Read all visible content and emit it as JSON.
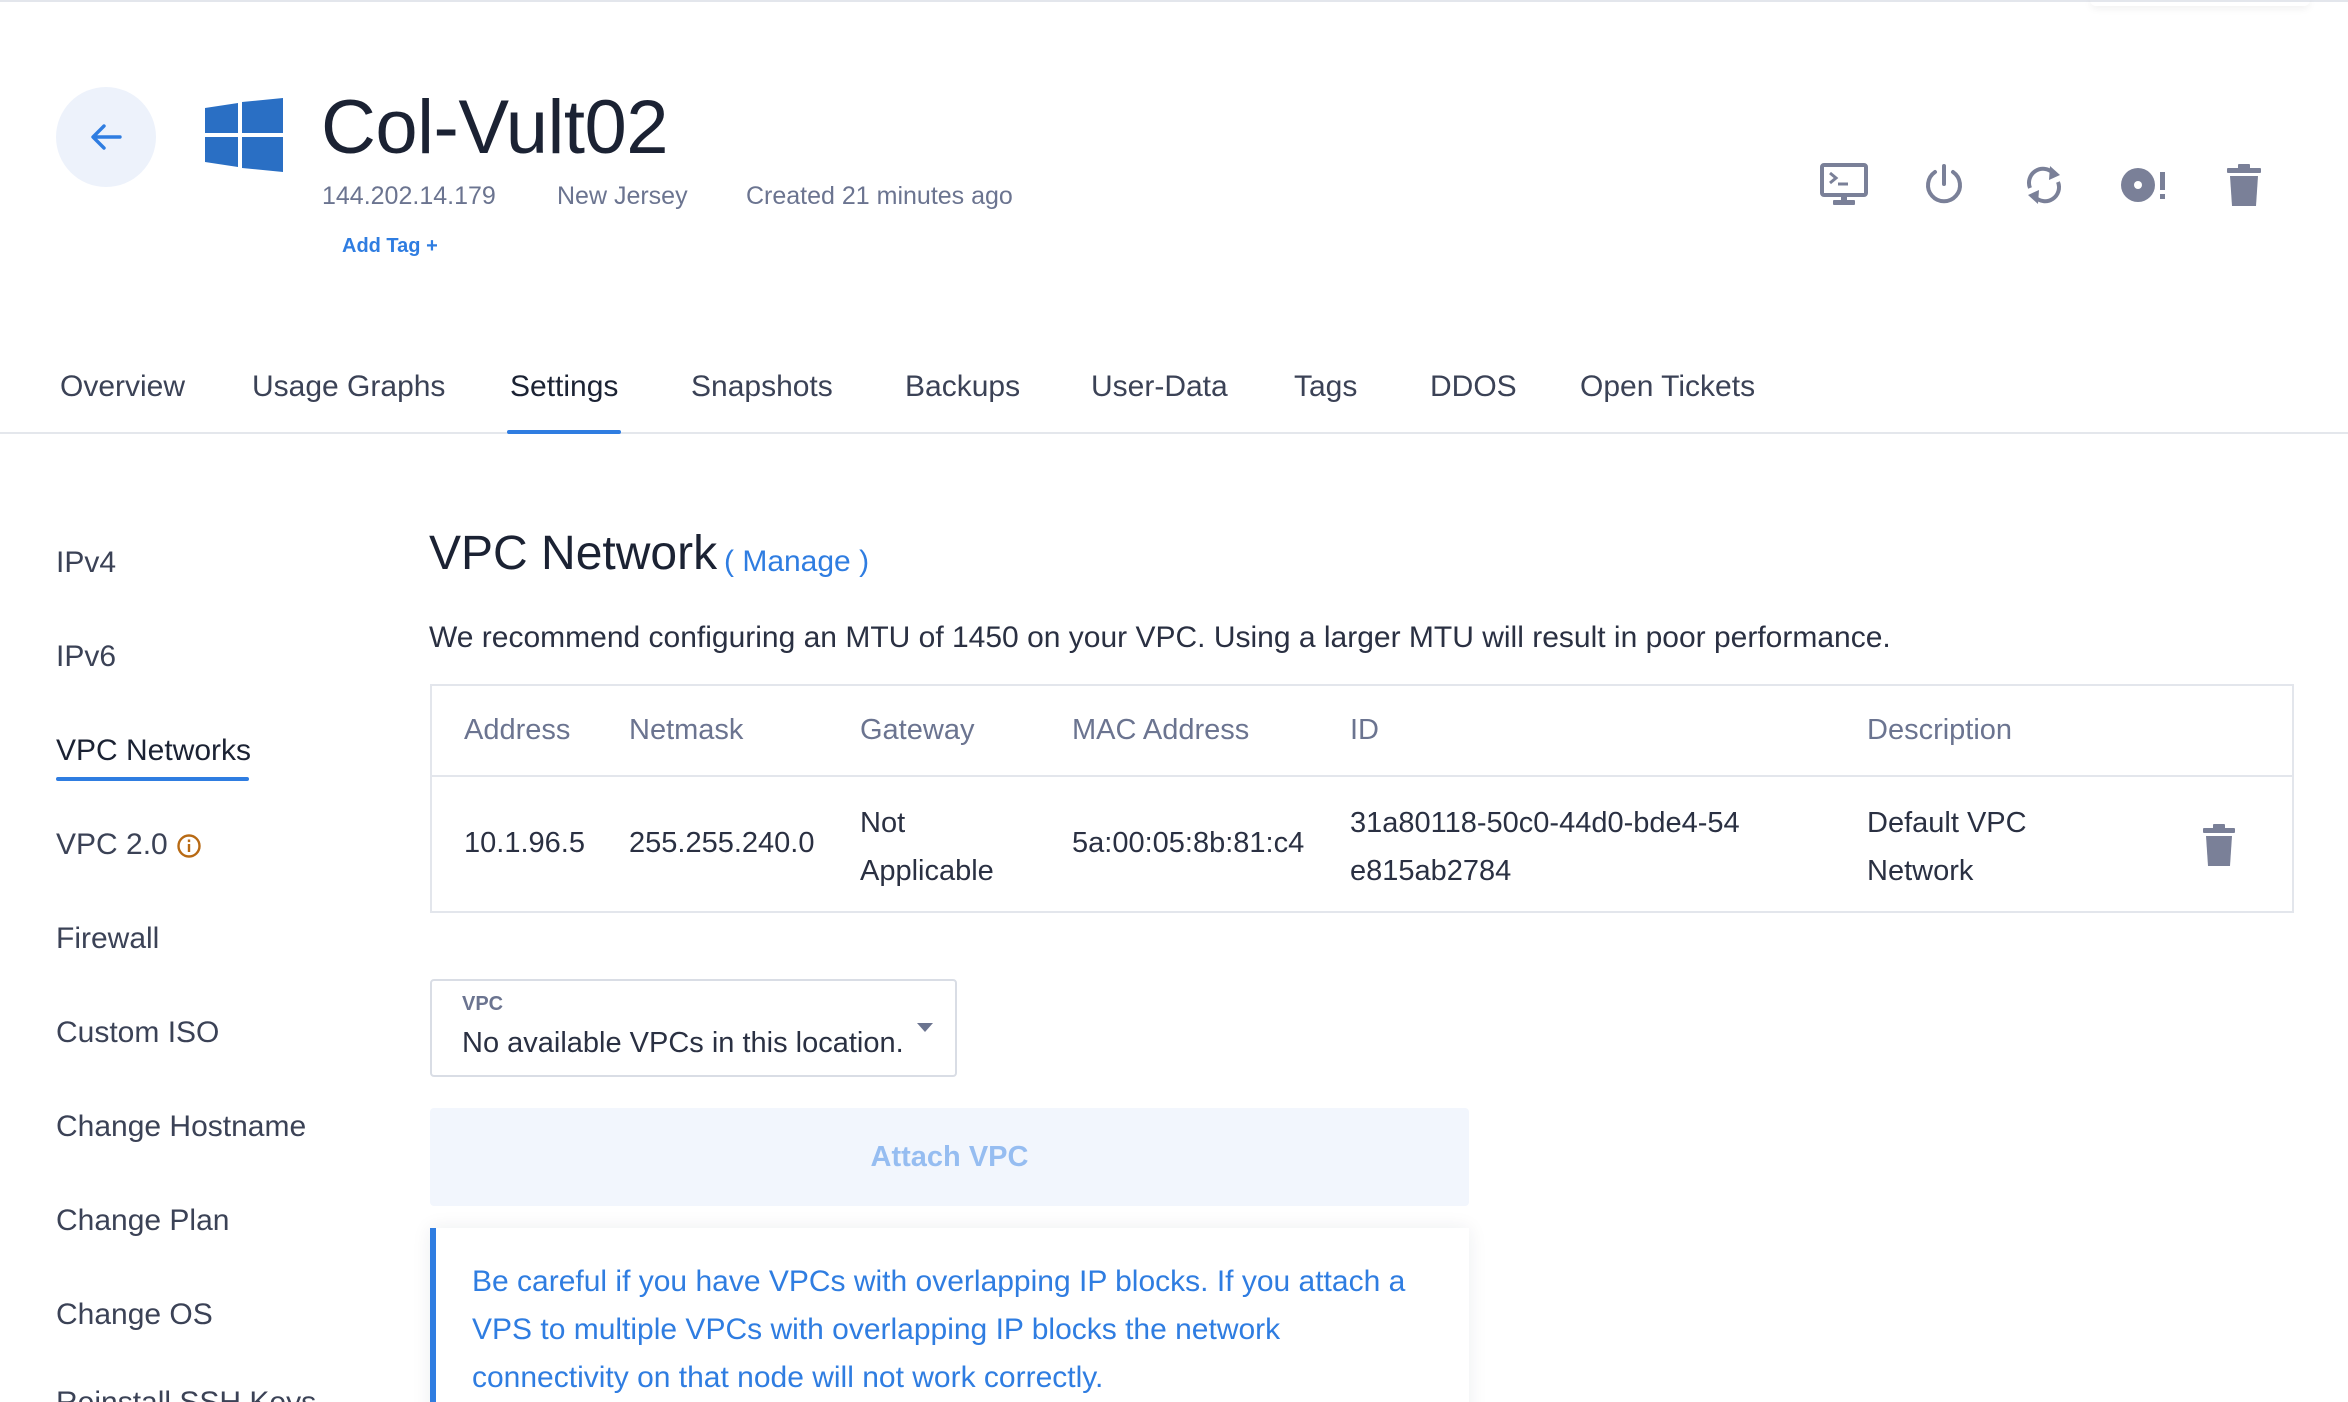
{
  "server": {
    "name": "Col-Vult02",
    "ip": "144.202.14.179",
    "location": "New Jersey",
    "created": "Created 21 minutes ago",
    "add_tag": "Add Tag +"
  },
  "actions": [
    "console-icon",
    "power-icon",
    "restart-icon",
    "reinstall-icon",
    "trash-icon"
  ],
  "tabs": [
    {
      "label": "Overview"
    },
    {
      "label": "Usage Graphs"
    },
    {
      "label": "Settings",
      "active": true
    },
    {
      "label": "Snapshots"
    },
    {
      "label": "Backups"
    },
    {
      "label": "User-Data"
    },
    {
      "label": "Tags"
    },
    {
      "label": "DDOS"
    },
    {
      "label": "Open Tickets"
    }
  ],
  "sidebar": {
    "items": [
      {
        "label": "IPv4"
      },
      {
        "label": "IPv6"
      },
      {
        "label": "VPC Networks",
        "active": true
      },
      {
        "label": "VPC 2.0"
      },
      {
        "label": "Firewall"
      },
      {
        "label": "Custom ISO"
      },
      {
        "label": "Change Hostname"
      },
      {
        "label": "Change Plan"
      },
      {
        "label": "Change OS"
      },
      {
        "label": "Reinstall SSH Keys"
      }
    ]
  },
  "vpc": {
    "title": "VPC Network",
    "manage": "( Manage )",
    "notice": "We recommend configuring an MTU of 1450 on your VPC. Using a larger MTU will result in poor performance.",
    "table": {
      "headers": [
        "Address",
        "Netmask",
        "Gateway",
        "MAC Address",
        "ID",
        "Description"
      ],
      "rows": [
        {
          "address": "10.1.96.5",
          "netmask": "255.255.240.0",
          "gateway": "Not Applicable",
          "mac": "5a:00:05:8b:81:c4",
          "id": "31a80118-50c0-44d0-bde4-54e815ab2784",
          "description": "Default VPC Network"
        }
      ]
    },
    "select": {
      "label": "VPC",
      "value": "No available VPCs in this location."
    },
    "attach_button": "Attach VPC",
    "warning": "Be careful if you have VPCs with overlapping IP blocks. If you attach a VPS to multiple VPCs with overlapping IP blocks the network connectivity on that node will not work correctly."
  },
  "colors": {
    "accent": "#2f7de1",
    "icon": "#7a8098",
    "muted_text": "#6b7490"
  }
}
